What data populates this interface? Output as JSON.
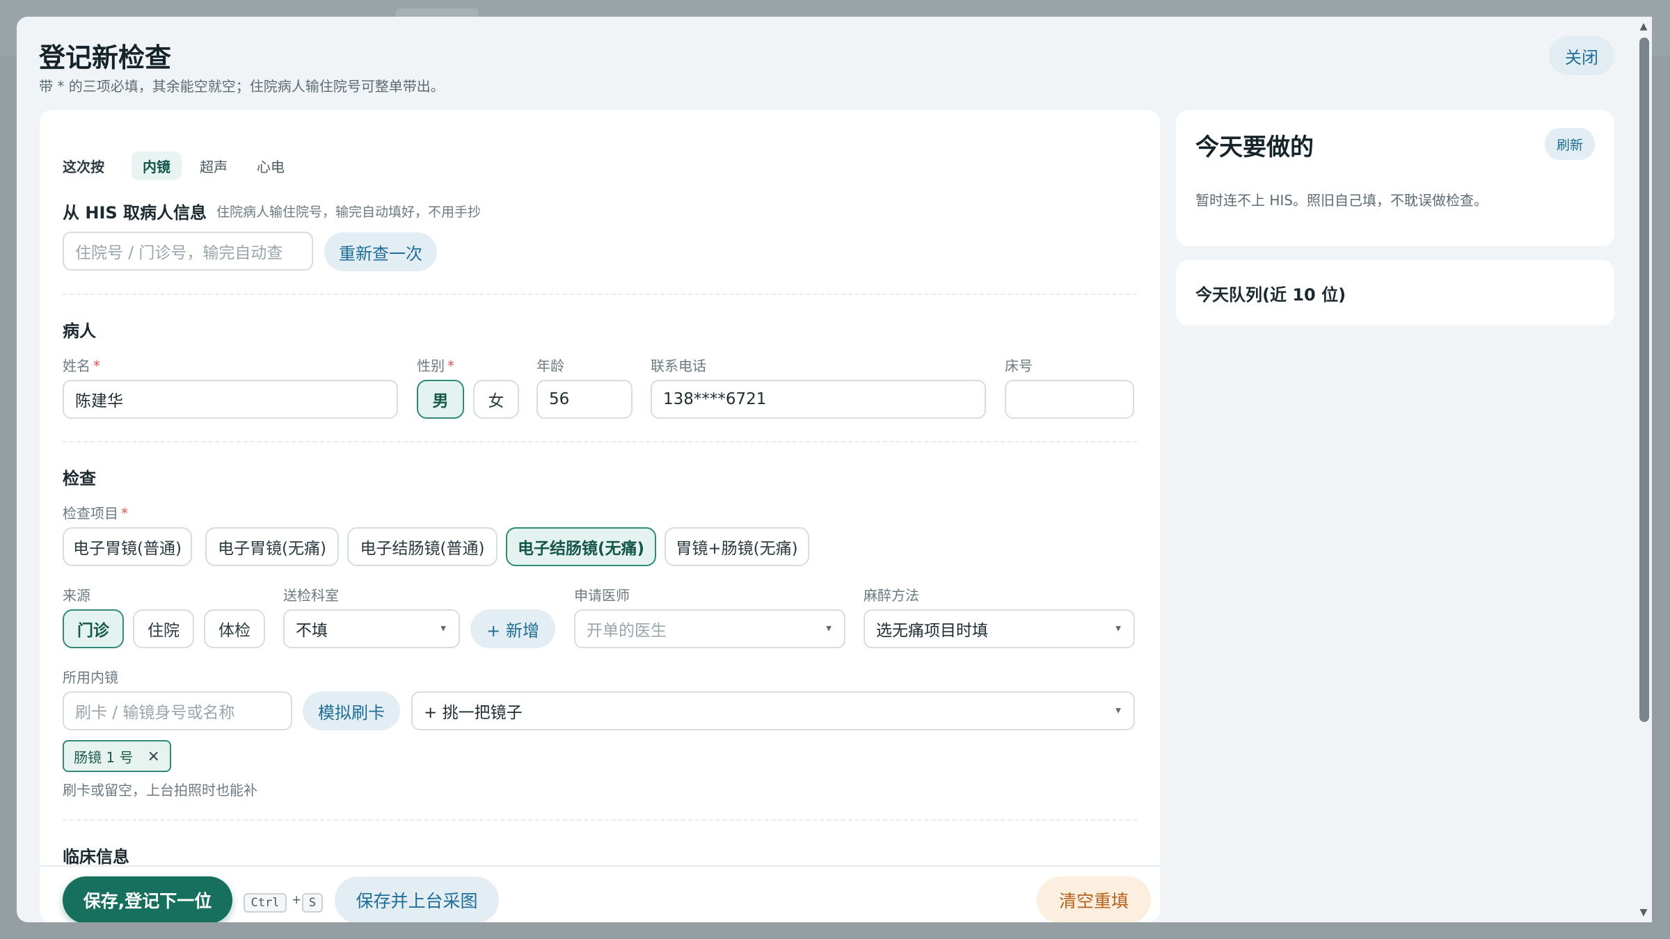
{
  "modal": {
    "title": "登记新检查",
    "subtitle": "带 * 的三项必填，其余能空就空；住院病人输住院号可整单带出。",
    "close_label": "关闭"
  },
  "mode": {
    "label": "这次按",
    "tabs": [
      "内镜",
      "超声",
      "心电"
    ],
    "active": "内镜"
  },
  "his": {
    "title": "从 HIS 取病人信息",
    "hint": "住院病人输住院号，输完自动填好，不用手抄",
    "input_placeholder": "住院号 / 门诊号，输完自动查",
    "requery_label": "重新查一次"
  },
  "patient": {
    "section_title": "病人",
    "name_label": "姓名",
    "name_value": "陈建华",
    "gender_label": "性别",
    "gender_options": [
      "男",
      "女"
    ],
    "gender_selected": "男",
    "age_label": "年龄",
    "age_value": "56",
    "phone_label": "联系电话",
    "phone_value": "138****6721",
    "bed_label": "床号",
    "bed_value": "",
    "required_mark": "*"
  },
  "exam": {
    "section_title": "检查",
    "items_label": "检查项目",
    "items": [
      "电子胃镜(普通)",
      "电子胃镜(无痛)",
      "电子结肠镜(普通)",
      "电子结肠镜(无痛)",
      "胃镜+肠镜(无痛)"
    ],
    "selected_item": "电子结肠镜(无痛)",
    "source_label": "来源",
    "sources": [
      "门诊",
      "住院",
      "体检"
    ],
    "selected_source": "门诊",
    "dept_label": "送检科室",
    "dept_value": "不填",
    "add_dept_label": "+ 新增",
    "doctor_label": "申请医师",
    "doctor_placeholder": "开单的医生",
    "anesthesia_label": "麻醉方法",
    "anesthesia_value": "选无痛项目时填",
    "scope_label": "所用内镜",
    "scope_input_placeholder": "刷卡 / 输镜身号或名称",
    "simulate_swipe_label": "模拟刷卡",
    "pick_scope_label": "+ 挑一把镜子",
    "selected_scope_tag": "肠镜 1 号",
    "tag_remove": "×",
    "scope_hint": "刷卡或留空，上台拍照时也能补"
  },
  "clinical": {
    "section_title": "临床信息"
  },
  "footer": {
    "save_next_label": "保存,登记下一位",
    "shortcut_key1": "Ctrl",
    "shortcut_plus": "+",
    "shortcut_key2": "S",
    "save_capture_label": "保存并上台采图",
    "clear_label": "清空重填"
  },
  "side": {
    "todo_title": "今天要做的",
    "refresh_label": "刷新",
    "todo_message": "暂时连不上 HIS。照旧自己填，不耽误做检查。",
    "queue_title": "今天队列(近 10 位)"
  },
  "icons": {
    "caret": "dropdown-caret-icon",
    "scroll_up": "scroll-up-arrow-icon",
    "scroll_down": "scroll-down-arrow-icon",
    "tag_close": "close-icon"
  },
  "colors": {
    "primary": "#17705e",
    "accent_blue": "#1f6e96",
    "warm": "#b4621b",
    "required": "#d9534f"
  }
}
